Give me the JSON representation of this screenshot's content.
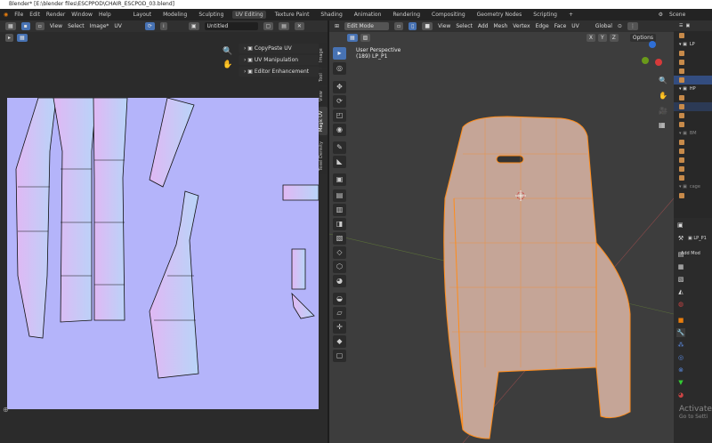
{
  "window": {
    "title": "Blender* [E:\\blender files\\ESCPPOD\\CHAIR_ESCPOD_03.blend]"
  },
  "menu": [
    "File",
    "Edit",
    "Render",
    "Window",
    "Help"
  ],
  "workspaces": [
    "Layout",
    "Modeling",
    "Sculpting",
    "UV Editing",
    "Texture Paint",
    "Shading",
    "Animation",
    "Rendering",
    "Compositing",
    "Geometry Nodes",
    "Scripting",
    "+"
  ],
  "active_workspace": "UV Editing",
  "scene": "Scene",
  "uv_editor": {
    "menus": [
      "View",
      "Select",
      "Image*",
      "UV"
    ],
    "image_name": "Untitled",
    "panels": [
      "CopyPaste UV",
      "UV Manipulation",
      "Editor Enhancement"
    ],
    "side_tabs": [
      "Image",
      "Tool",
      "View",
      "Magic UV",
      "Texel Density"
    ],
    "active_tab": "Magic UV"
  },
  "viewport": {
    "mode": "Edit Mode",
    "menus": [
      "View",
      "Select",
      "Add",
      "Mesh",
      "Vertex",
      "Edge",
      "Face",
      "UV"
    ],
    "orientation": "Global",
    "options": "Options",
    "axes": [
      "X",
      "Y",
      "Z"
    ],
    "overlay_title": "User Perspective",
    "overlay_object": "(189) LP_P1"
  },
  "outliner": {
    "collections": [
      "LP",
      "HP",
      "BM",
      "cage"
    ]
  },
  "properties": {
    "object": "LP_P1",
    "add_modifier": "Add Mod"
  },
  "watermark": {
    "line1": "Activate",
    "line2": "Go to Setti"
  },
  "colors": {
    "accent": "#4772b3",
    "uv_bg": "#b4b4fa",
    "mesh_edge": "#ff8c1a"
  }
}
